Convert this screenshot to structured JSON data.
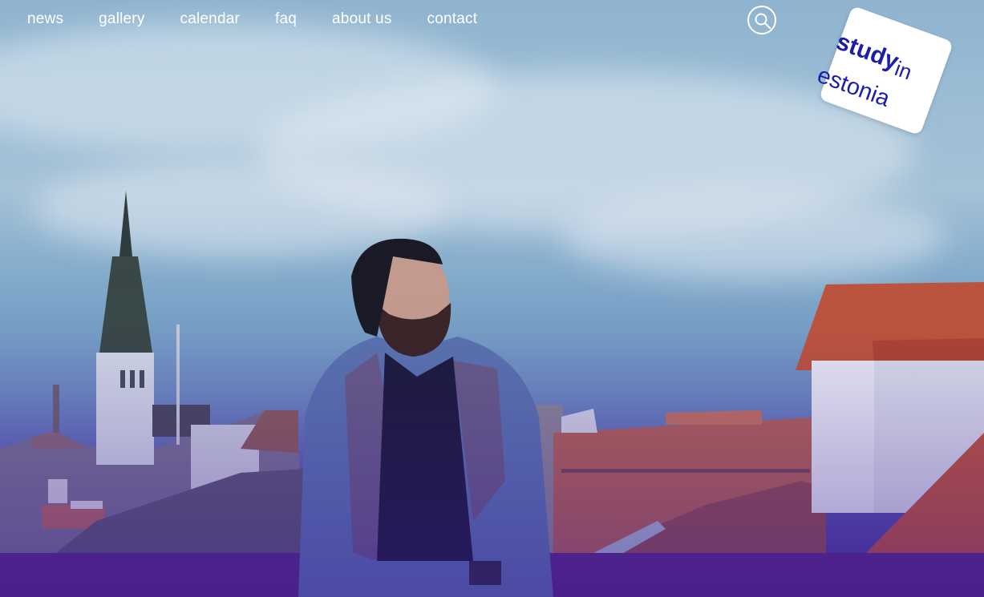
{
  "nav": {
    "items": [
      {
        "label": "news"
      },
      {
        "label": "gallery"
      },
      {
        "label": "calendar"
      },
      {
        "label": "faq"
      },
      {
        "label": "about us"
      },
      {
        "label": "contact"
      }
    ]
  },
  "search": {
    "icon": "search-icon"
  },
  "logo": {
    "line1": "study",
    "line1b": "in",
    "line2": "estonia"
  },
  "colors": {
    "logo_text": "#1b1ea8",
    "nav_text": "#ffffff",
    "overlay": "#4a2f95"
  }
}
